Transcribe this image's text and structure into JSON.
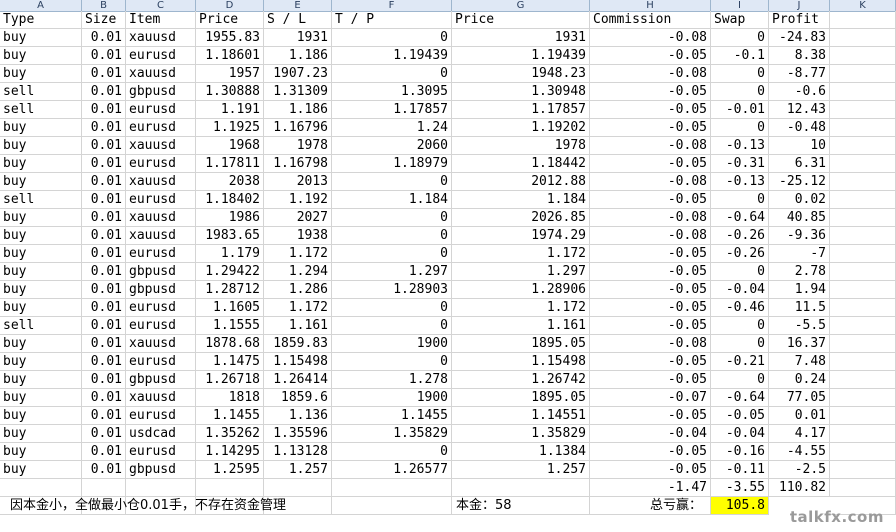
{
  "columns": [
    "A",
    "B",
    "C",
    "D",
    "E",
    "F",
    "G",
    "H",
    "I",
    "J",
    "K"
  ],
  "header": [
    "Type",
    "Size",
    "Item",
    "Price",
    "S / L",
    "T / P",
    "Price",
    "Commission",
    "Swap",
    "Profit"
  ],
  "rows": [
    [
      "buy",
      "0.01",
      "xauusd",
      "1955.83",
      "1931",
      "0",
      "1931",
      "-0.08",
      "0",
      "-24.83"
    ],
    [
      "buy",
      "0.01",
      "eurusd",
      "1.18601",
      "1.186",
      "1.19439",
      "1.19439",
      "-0.05",
      "-0.1",
      "8.38"
    ],
    [
      "buy",
      "0.01",
      "xauusd",
      "1957",
      "1907.23",
      "0",
      "1948.23",
      "-0.08",
      "0",
      "-8.77"
    ],
    [
      "sell",
      "0.01",
      "gbpusd",
      "1.30888",
      "1.31309",
      "1.3095",
      "1.30948",
      "-0.05",
      "0",
      "-0.6"
    ],
    [
      "sell",
      "0.01",
      "eurusd",
      "1.191",
      "1.186",
      "1.17857",
      "1.17857",
      "-0.05",
      "-0.01",
      "12.43"
    ],
    [
      "buy",
      "0.01",
      "eurusd",
      "1.1925",
      "1.16796",
      "1.24",
      "1.19202",
      "-0.05",
      "0",
      "-0.48"
    ],
    [
      "buy",
      "0.01",
      "xauusd",
      "1968",
      "1978",
      "2060",
      "1978",
      "-0.08",
      "-0.13",
      "10"
    ],
    [
      "buy",
      "0.01",
      "eurusd",
      "1.17811",
      "1.16798",
      "1.18979",
      "1.18442",
      "-0.05",
      "-0.31",
      "6.31"
    ],
    [
      "buy",
      "0.01",
      "xauusd",
      "2038",
      "2013",
      "0",
      "2012.88",
      "-0.08",
      "-0.13",
      "-25.12"
    ],
    [
      "sell",
      "0.01",
      "eurusd",
      "1.18402",
      "1.192",
      "1.184",
      "1.184",
      "-0.05",
      "0",
      "0.02"
    ],
    [
      "buy",
      "0.01",
      "xauusd",
      "1986",
      "2027",
      "0",
      "2026.85",
      "-0.08",
      "-0.64",
      "40.85"
    ],
    [
      "buy",
      "0.01",
      "xauusd",
      "1983.65",
      "1938",
      "0",
      "1974.29",
      "-0.08",
      "-0.26",
      "-9.36"
    ],
    [
      "buy",
      "0.01",
      "eurusd",
      "1.179",
      "1.172",
      "0",
      "1.172",
      "-0.05",
      "-0.26",
      "-7"
    ],
    [
      "buy",
      "0.01",
      "gbpusd",
      "1.29422",
      "1.294",
      "1.297",
      "1.297",
      "-0.05",
      "0",
      "2.78"
    ],
    [
      "buy",
      "0.01",
      "gbpusd",
      "1.28712",
      "1.286",
      "1.28903",
      "1.28906",
      "-0.05",
      "-0.04",
      "1.94"
    ],
    [
      "buy",
      "0.01",
      "eurusd",
      "1.1605",
      "1.172",
      "0",
      "1.172",
      "-0.05",
      "-0.46",
      "11.5"
    ],
    [
      "sell",
      "0.01",
      "eurusd",
      "1.1555",
      "1.161",
      "0",
      "1.161",
      "-0.05",
      "0",
      "-5.5"
    ],
    [
      "buy",
      "0.01",
      "xauusd",
      "1878.68",
      "1859.83",
      "1900",
      "1895.05",
      "-0.08",
      "0",
      "16.37"
    ],
    [
      "buy",
      "0.01",
      "eurusd",
      "1.1475",
      "1.15498",
      "0",
      "1.15498",
      "-0.05",
      "-0.21",
      "7.48"
    ],
    [
      "buy",
      "0.01",
      "gbpusd",
      "1.26718",
      "1.26414",
      "1.278",
      "1.26742",
      "-0.05",
      "0",
      "0.24"
    ],
    [
      "buy",
      "0.01",
      "xauusd",
      "1818",
      "1859.6",
      "1900",
      "1895.05",
      "-0.07",
      "-0.64",
      "77.05"
    ],
    [
      "buy",
      "0.01",
      "eurusd",
      "1.1455",
      "1.136",
      "1.1455",
      "1.14551",
      "-0.05",
      "-0.05",
      "0.01"
    ],
    [
      "buy",
      "0.01",
      "usdcad",
      "1.35262",
      "1.35596",
      "1.35829",
      "1.35829",
      "-0.04",
      "-0.04",
      "4.17"
    ],
    [
      "buy",
      "0.01",
      "eurusd",
      "1.14295",
      "1.13128",
      "0",
      "1.1384",
      "-0.05",
      "-0.16",
      "-4.55"
    ],
    [
      "buy",
      "0.01",
      "gbpusd",
      "1.2595",
      "1.257",
      "1.26577",
      "1.257",
      "-0.05",
      "-0.11",
      "-2.5"
    ]
  ],
  "totals": {
    "commission": "-1.47",
    "swap": "-3.55",
    "profit": "110.82"
  },
  "footer": {
    "note": "因本金小，全做最小仓0.01手，不存在资金管理",
    "capital": "本金：58",
    "total_label": "总亏赢：",
    "total_value": "105.8"
  },
  "watermark": "talkfx.com",
  "colors": {
    "header_bg": "#dfe8f5",
    "highlight": "#ffff00",
    "grid": "#d4d4d4"
  }
}
